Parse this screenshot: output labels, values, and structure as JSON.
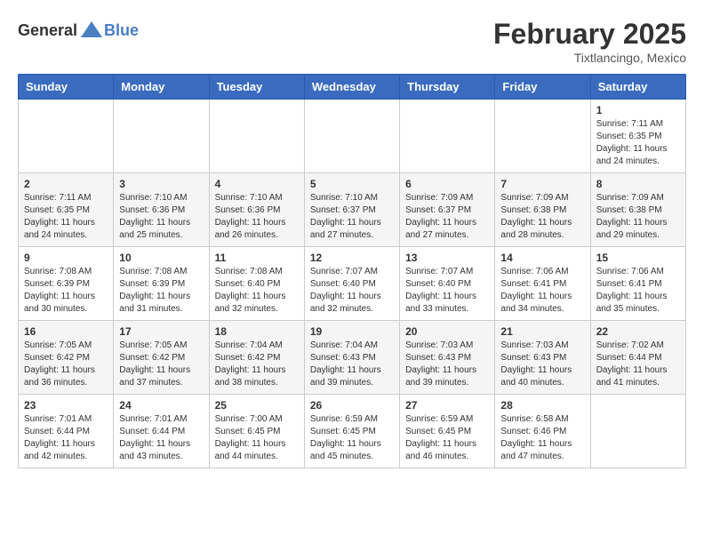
{
  "header": {
    "logo_general": "General",
    "logo_blue": "Blue",
    "month": "February 2025",
    "location": "Tixtlancingo, Mexico"
  },
  "days_of_week": [
    "Sunday",
    "Monday",
    "Tuesday",
    "Wednesday",
    "Thursday",
    "Friday",
    "Saturday"
  ],
  "weeks": [
    [
      {
        "day": "",
        "info": ""
      },
      {
        "day": "",
        "info": ""
      },
      {
        "day": "",
        "info": ""
      },
      {
        "day": "",
        "info": ""
      },
      {
        "day": "",
        "info": ""
      },
      {
        "day": "",
        "info": ""
      },
      {
        "day": "1",
        "info": "Sunrise: 7:11 AM\nSunset: 6:35 PM\nDaylight: 11 hours and 24 minutes."
      }
    ],
    [
      {
        "day": "2",
        "info": "Sunrise: 7:11 AM\nSunset: 6:35 PM\nDaylight: 11 hours and 24 minutes."
      },
      {
        "day": "3",
        "info": "Sunrise: 7:10 AM\nSunset: 6:36 PM\nDaylight: 11 hours and 25 minutes."
      },
      {
        "day": "4",
        "info": "Sunrise: 7:10 AM\nSunset: 6:36 PM\nDaylight: 11 hours and 26 minutes."
      },
      {
        "day": "5",
        "info": "Sunrise: 7:10 AM\nSunset: 6:37 PM\nDaylight: 11 hours and 27 minutes."
      },
      {
        "day": "6",
        "info": "Sunrise: 7:09 AM\nSunset: 6:37 PM\nDaylight: 11 hours and 27 minutes."
      },
      {
        "day": "7",
        "info": "Sunrise: 7:09 AM\nSunset: 6:38 PM\nDaylight: 11 hours and 28 minutes."
      },
      {
        "day": "8",
        "info": "Sunrise: 7:09 AM\nSunset: 6:38 PM\nDaylight: 11 hours and 29 minutes."
      }
    ],
    [
      {
        "day": "9",
        "info": "Sunrise: 7:08 AM\nSunset: 6:39 PM\nDaylight: 11 hours and 30 minutes."
      },
      {
        "day": "10",
        "info": "Sunrise: 7:08 AM\nSunset: 6:39 PM\nDaylight: 11 hours and 31 minutes."
      },
      {
        "day": "11",
        "info": "Sunrise: 7:08 AM\nSunset: 6:40 PM\nDaylight: 11 hours and 32 minutes."
      },
      {
        "day": "12",
        "info": "Sunrise: 7:07 AM\nSunset: 6:40 PM\nDaylight: 11 hours and 32 minutes."
      },
      {
        "day": "13",
        "info": "Sunrise: 7:07 AM\nSunset: 6:40 PM\nDaylight: 11 hours and 33 minutes."
      },
      {
        "day": "14",
        "info": "Sunrise: 7:06 AM\nSunset: 6:41 PM\nDaylight: 11 hours and 34 minutes."
      },
      {
        "day": "15",
        "info": "Sunrise: 7:06 AM\nSunset: 6:41 PM\nDaylight: 11 hours and 35 minutes."
      }
    ],
    [
      {
        "day": "16",
        "info": "Sunrise: 7:05 AM\nSunset: 6:42 PM\nDaylight: 11 hours and 36 minutes."
      },
      {
        "day": "17",
        "info": "Sunrise: 7:05 AM\nSunset: 6:42 PM\nDaylight: 11 hours and 37 minutes."
      },
      {
        "day": "18",
        "info": "Sunrise: 7:04 AM\nSunset: 6:42 PM\nDaylight: 11 hours and 38 minutes."
      },
      {
        "day": "19",
        "info": "Sunrise: 7:04 AM\nSunset: 6:43 PM\nDaylight: 11 hours and 39 minutes."
      },
      {
        "day": "20",
        "info": "Sunrise: 7:03 AM\nSunset: 6:43 PM\nDaylight: 11 hours and 39 minutes."
      },
      {
        "day": "21",
        "info": "Sunrise: 7:03 AM\nSunset: 6:43 PM\nDaylight: 11 hours and 40 minutes."
      },
      {
        "day": "22",
        "info": "Sunrise: 7:02 AM\nSunset: 6:44 PM\nDaylight: 11 hours and 41 minutes."
      }
    ],
    [
      {
        "day": "23",
        "info": "Sunrise: 7:01 AM\nSunset: 6:44 PM\nDaylight: 11 hours and 42 minutes."
      },
      {
        "day": "24",
        "info": "Sunrise: 7:01 AM\nSunset: 6:44 PM\nDaylight: 11 hours and 43 minutes."
      },
      {
        "day": "25",
        "info": "Sunrise: 7:00 AM\nSunset: 6:45 PM\nDaylight: 11 hours and 44 minutes."
      },
      {
        "day": "26",
        "info": "Sunrise: 6:59 AM\nSunset: 6:45 PM\nDaylight: 11 hours and 45 minutes."
      },
      {
        "day": "27",
        "info": "Sunrise: 6:59 AM\nSunset: 6:45 PM\nDaylight: 11 hours and 46 minutes."
      },
      {
        "day": "28",
        "info": "Sunrise: 6:58 AM\nSunset: 6:46 PM\nDaylight: 11 hours and 47 minutes."
      },
      {
        "day": "",
        "info": ""
      }
    ]
  ]
}
